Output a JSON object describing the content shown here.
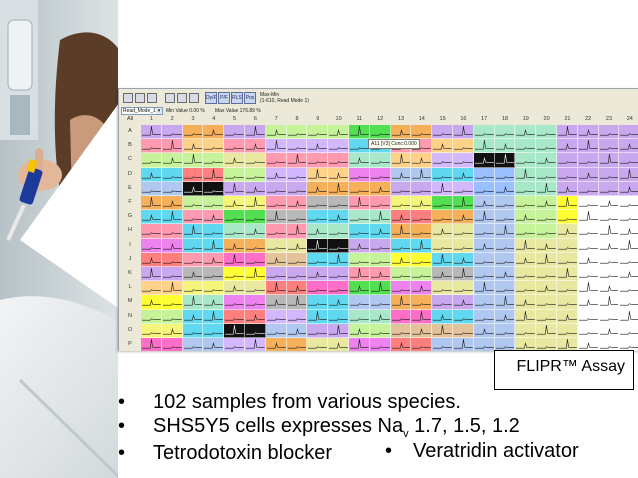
{
  "toolbar": {
    "mode_select_value": "Read_Mode_1",
    "min_value_label": "Min Value 0.00 %",
    "max_value_label": "Max Value 176.89 %",
    "max_min_title": "Max-Min",
    "max_min_subtitle": "(1-610, Read Mode 1)",
    "button_labels": [
      "Dy/F",
      "P/F",
      "RLS",
      "Pos"
    ]
  },
  "plate": {
    "corner_label": "All",
    "columns": [
      "1",
      "2",
      "3",
      "4",
      "5",
      "6",
      "7",
      "8",
      "9",
      "10",
      "11",
      "12",
      "13",
      "14",
      "15",
      "16",
      "17",
      "18",
      "19",
      "20",
      "21",
      "22",
      "23",
      "24"
    ],
    "rows": [
      "A",
      "B",
      "C",
      "D",
      "E",
      "F",
      "G",
      "H",
      "I",
      "J",
      "K",
      "L",
      "M",
      "N",
      "O",
      "P"
    ],
    "palette": [
      "#c9a8f0",
      "#f7b05a",
      "#c6f29a",
      "#52e052",
      "#7fdede",
      "#ff9ab0",
      "#ee82ee",
      "#f5f57a",
      "#b0c8f0",
      "#e8e8a0",
      "#a8e8c8",
      "#ff6ec7",
      "#111111",
      "#9ac0ff",
      "#ffd28a",
      "#d4b8ff",
      "#60d8f0",
      "#ffff33",
      "#b8b8b8",
      "#e5c39a",
      "#ff7f7f",
      "#8af0c8"
    ],
    "block_colors": [
      [
        0,
        1,
        0,
        2,
        2,
        3,
        1,
        0,
        10,
        10,
        0
      ],
      [
        5,
        14,
        5,
        15,
        15,
        16,
        5,
        14,
        10,
        10,
        0
      ],
      [
        2,
        2,
        9,
        5,
        5,
        10,
        14,
        15,
        12,
        10,
        0
      ],
      [
        16,
        20,
        2,
        15,
        14,
        6,
        8,
        16,
        13,
        10,
        0
      ],
      [
        8,
        12,
        0,
        0,
        1,
        1,
        0,
        15,
        13,
        10,
        0
      ],
      [
        1,
        2,
        7,
        5,
        18,
        5,
        7,
        3,
        8,
        2,
        17
      ],
      [
        16,
        5,
        3,
        18,
        16,
        10,
        20,
        1,
        8,
        2,
        17
      ],
      [
        5,
        16,
        10,
        5,
        10,
        16,
        1,
        9,
        8,
        2,
        9
      ],
      [
        6,
        16,
        1,
        9,
        12,
        0,
        16,
        9,
        8,
        9,
        9
      ],
      [
        20,
        5,
        11,
        19,
        16,
        2,
        17,
        16,
        8,
        9,
        9
      ],
      [
        0,
        18,
        17,
        0,
        0,
        5,
        2,
        18,
        8,
        9,
        9
      ],
      [
        14,
        7,
        9,
        20,
        11,
        3,
        6,
        9,
        8,
        9,
        9
      ],
      [
        17,
        10,
        6,
        18,
        16,
        8,
        1,
        0,
        8,
        9,
        9
      ],
      [
        2,
        16,
        20,
        15,
        16,
        10,
        11,
        16,
        8,
        9,
        9
      ],
      [
        7,
        16,
        12,
        8,
        0,
        2,
        19,
        19,
        8,
        9,
        9
      ],
      [
        11,
        8,
        15,
        1,
        9,
        6,
        20,
        8,
        8,
        9,
        9
      ]
    ],
    "tooltip": "A11  [V3] Conc:0.000"
  },
  "caption_box": {
    "text": "FLIPR™ Assay"
  },
  "bullets": [
    {
      "dot": "•",
      "text": "102 samples from various species."
    },
    {
      "dot": "•",
      "text_before": "SHS5Y5 cells expresses Na",
      "subscript": "v",
      "text_after": " 1.7, 1.5, 1.2"
    },
    {
      "dot": "•",
      "text": "Tetrodotoxin blocker"
    },
    {
      "dot": "•",
      "text": "Veratridin activator"
    }
  ]
}
